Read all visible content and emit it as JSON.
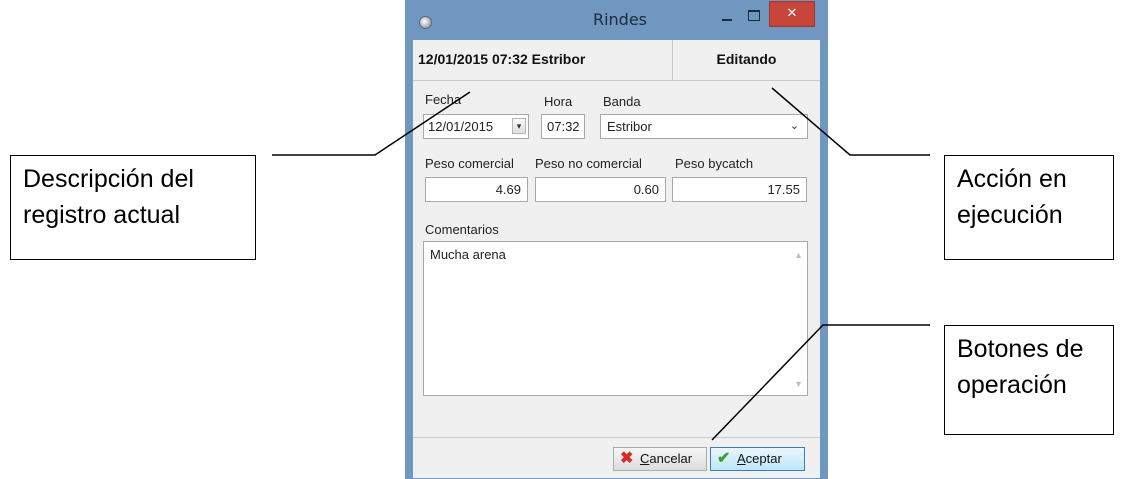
{
  "window": {
    "title": "Rindes",
    "close_glyph": "✕"
  },
  "header": {
    "record_description": "12/01/2015 07:32 Estribor",
    "current_action": "Editando"
  },
  "form": {
    "fecha": {
      "label": "Fecha",
      "value": "12/01/2015"
    },
    "hora": {
      "label": "Hora",
      "value": "07:32"
    },
    "banda": {
      "label": "Banda",
      "value": "Estribor"
    },
    "peso_comercial": {
      "label": "Peso comercial",
      "value": "4.69"
    },
    "peso_no_comercial": {
      "label": "Peso no comercial",
      "value": "0.60"
    },
    "peso_bycatch": {
      "label": "Peso bycatch",
      "value": "17.55"
    },
    "comentarios": {
      "label": "Comentarios",
      "value": "Mucha arena"
    }
  },
  "buttons": {
    "cancel": {
      "mnemonic": "C",
      "rest": "ancelar",
      "icon": "red-x-icon"
    },
    "accept": {
      "mnemonic": "A",
      "rest": "ceptar",
      "icon": "green-check-icon"
    }
  },
  "callouts": {
    "descripcion": {
      "line1": "Descripción del",
      "line2": "registro actual"
    },
    "accion": {
      "line1": "Acción en",
      "line2": "ejecución"
    },
    "botones": {
      "line1": "Botones de",
      "line2": "operación"
    }
  },
  "colors": {
    "window_frame": "#6f97c0",
    "close_button": "#c7463a",
    "client_bg": "#f0f0f0"
  }
}
